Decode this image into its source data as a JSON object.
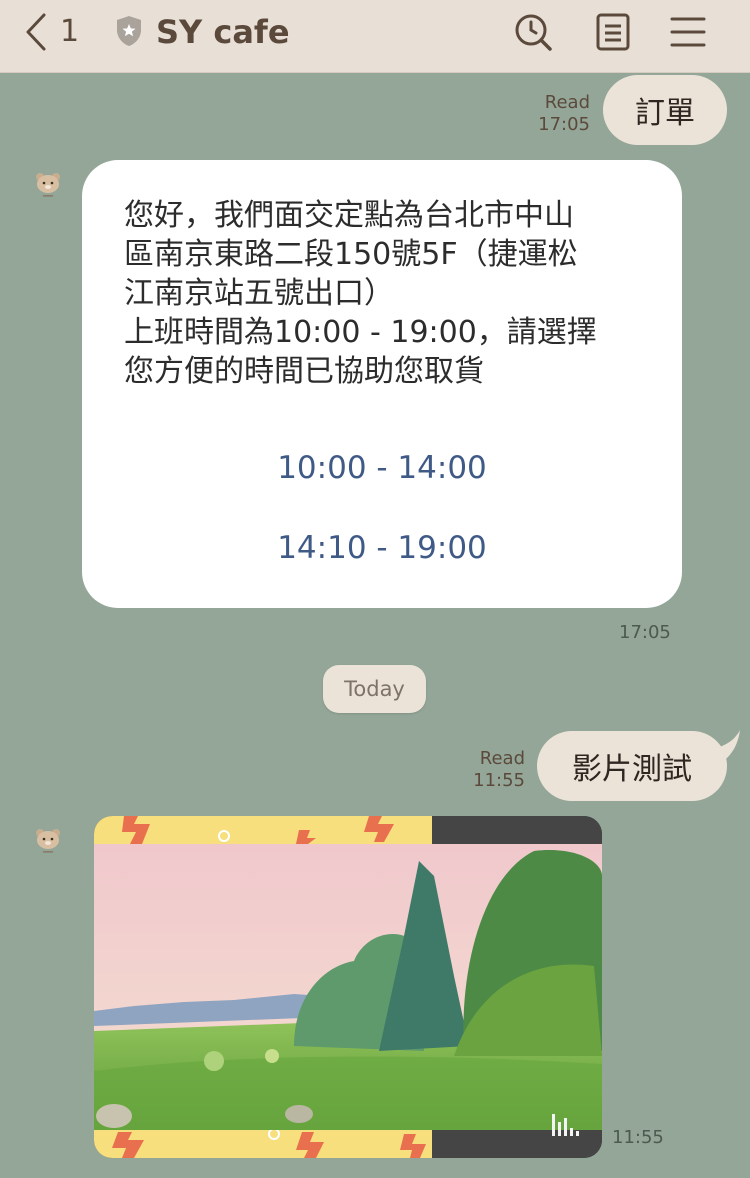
{
  "header": {
    "back_count": "1",
    "title": "SY cafe",
    "icons": [
      "chevron-left-icon",
      "shield-star-icon",
      "history-search-icon",
      "notes-icon",
      "menu-icon"
    ]
  },
  "messages": [
    {
      "side": "right",
      "text": "訂單",
      "read": "Read",
      "time": "17:05"
    },
    {
      "side": "left",
      "body": "您好，我們面交定點為台北市中山\n區南京東路二段150號5F（捷運松\n江南京站五號出口）\n上班時間為10:00 - 19:00，請選擇\n您方便的時間已協助您取貨",
      "options": [
        "10:00 - 14:00",
        "14:10 - 19:00"
      ],
      "time": "17:05"
    },
    {
      "side": "right",
      "text": "影片測試",
      "read": "Read",
      "time": "11:55"
    },
    {
      "side": "left",
      "type": "video",
      "time": "11:55"
    }
  ],
  "date_divider": "Today",
  "colors": {
    "background": "#94a698",
    "header": "#e8e0d6",
    "bubble_mine": "#ece3d8",
    "link": "#3f5a86"
  }
}
